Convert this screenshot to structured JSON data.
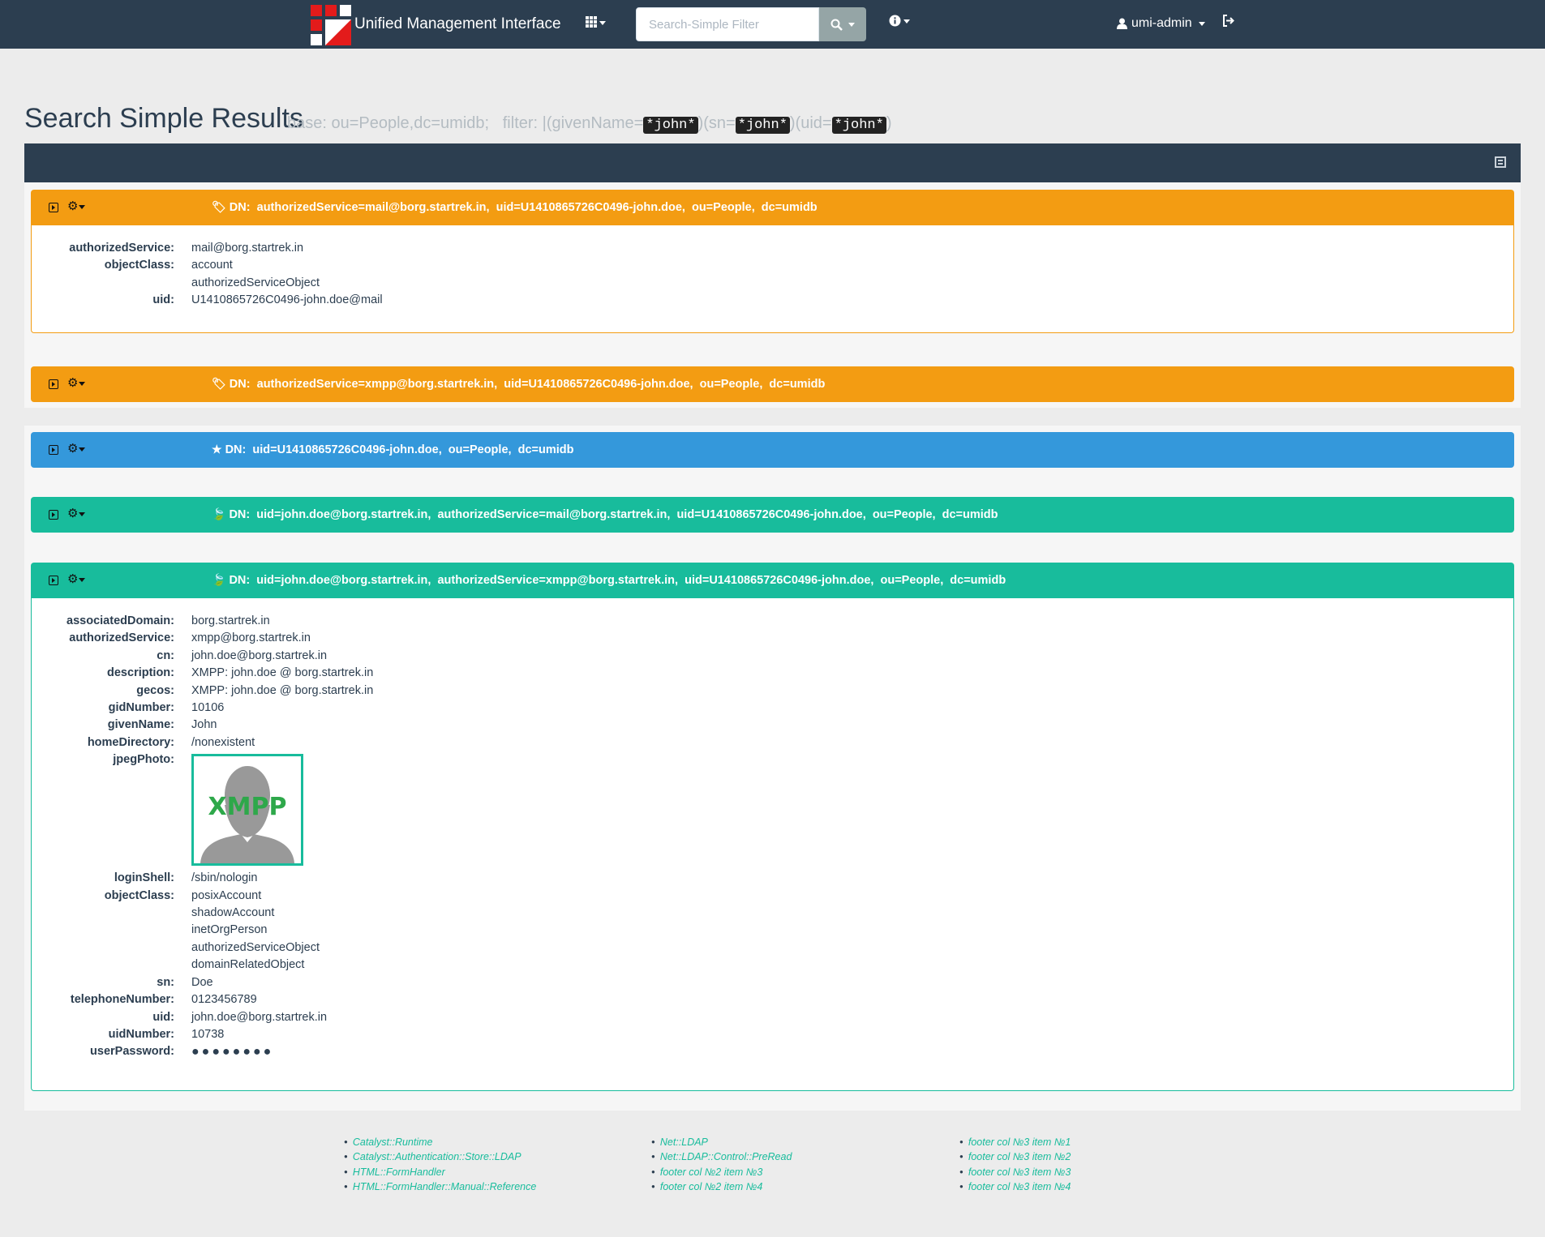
{
  "navbar": {
    "brand": "Unified Management Interface",
    "search_placeholder": "Search-Simple Filter",
    "user": "umi-admin",
    "icons": {
      "apps": "th-grid-icon",
      "search": "magnifier-icon",
      "info": "info-circle-icon",
      "user": "user-icon",
      "logout": "sign-out-icon"
    }
  },
  "page": {
    "title": "Search Simple Results",
    "base_label": "base: ou=People,dc=umidb;",
    "filter_prefix": "filter: |(givenName=",
    "filter_term": "*john*",
    "filter_sn": ")(sn=",
    "filter_uid": ")(uid=",
    "filter_close": ")"
  },
  "entries": [
    {
      "color": "#f39c12",
      "type_icon": "tag-icon",
      "dn_label": "DN:",
      "dn": "authorizedService=mail@borg.startrek.in,  uid=U1410865726C0496-john.doe,  ou=People,  dc=umidb",
      "attrs": [
        {
          "key": "authorizedService:",
          "values": [
            "mail@borg.startrek.in"
          ]
        },
        {
          "key": "objectClass:",
          "values": [
            "account",
            "authorizedServiceObject"
          ]
        },
        {
          "key": "uid:",
          "values": [
            "U1410865726C0496-john.doe@mail"
          ]
        }
      ]
    },
    {
      "color": "#f39c12",
      "type_icon": "tag-icon",
      "dn_label": "DN:",
      "dn": "authorizedService=xmpp@borg.startrek.in,  uid=U1410865726C0496-john.doe,  ou=People,  dc=umidb"
    },
    {
      "color": "#3498db",
      "type_icon": "star-icon",
      "dn_label": "DN:",
      "dn": "uid=U1410865726C0496-john.doe,  ou=People,  dc=umidb"
    },
    {
      "color": "#18bc9c",
      "type_icon": "leaf-icon",
      "dn_label": "DN:",
      "dn": "uid=john.doe@borg.startrek.in,  authorizedService=mail@borg.startrek.in,  uid=U1410865726C0496-john.doe,  ou=People,  dc=umidb"
    },
    {
      "color": "#18bc9c",
      "type_icon": "leaf-icon",
      "dn_label": "DN:",
      "dn": "uid=john.doe@borg.startrek.in,  authorizedService=xmpp@borg.startrek.in,  uid=U1410865726C0496-john.doe,  ou=People,  dc=umidb",
      "attrs": [
        {
          "key": "associatedDomain:",
          "values": [
            "borg.startrek.in"
          ]
        },
        {
          "key": "authorizedService:",
          "values": [
            "xmpp@borg.startrek.in"
          ]
        },
        {
          "key": "cn:",
          "values": [
            "john.doe@borg.startrek.in"
          ]
        },
        {
          "key": "description:",
          "values": [
            "XMPP: john.doe @ borg.startrek.in"
          ]
        },
        {
          "key": "gecos:",
          "values": [
            "XMPP: john.doe @ borg.startrek.in"
          ]
        },
        {
          "key": "gidNumber:",
          "values": [
            "10106"
          ]
        },
        {
          "key": "givenName:",
          "values": [
            "John"
          ]
        },
        {
          "key": "homeDirectory:",
          "values": [
            "/nonexistent"
          ]
        },
        {
          "key": "jpegPhoto:",
          "photo_text": "XMPP"
        },
        {
          "key": "loginShell:",
          "values": [
            "/sbin/nologin"
          ]
        },
        {
          "key": "objectClass:",
          "values": [
            "posixAccount",
            "shadowAccount",
            "inetOrgPerson",
            "authorizedServiceObject",
            "domainRelatedObject"
          ]
        },
        {
          "key": "sn:",
          "values": [
            "Doe"
          ]
        },
        {
          "key": "telephoneNumber:",
          "values": [
            "0123456789"
          ]
        },
        {
          "key": "uid:",
          "values": [
            "john.doe@borg.startrek.in"
          ]
        },
        {
          "key": "uidNumber:",
          "values": [
            "10738"
          ]
        },
        {
          "key": "userPassword:",
          "values": [
            "●●●●●●●●"
          ]
        }
      ]
    }
  ],
  "footer": {
    "col1": [
      "Catalyst::Runtime",
      "Catalyst::Authentication::Store::LDAP",
      "HTML::FormHandler",
      "HTML::FormHandler::Manual::Reference"
    ],
    "col2": [
      "Net::LDAP",
      "Net::LDAP::Control::PreRead",
      "footer col №2 item №3",
      "footer col №2 item №4"
    ],
    "col3": [
      "footer col №3 item №1",
      "footer col №3 item №2",
      "footer col №3 item №3",
      "footer col №3 item №4"
    ]
  }
}
